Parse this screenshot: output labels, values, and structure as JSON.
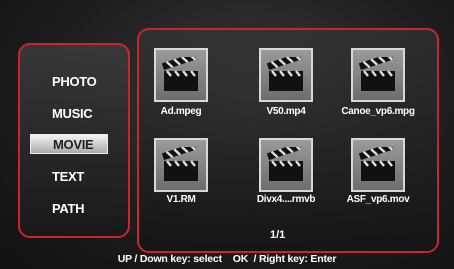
{
  "sidebar": {
    "items": [
      {
        "label": "PHOTO",
        "selected": false
      },
      {
        "label": "MUSIC",
        "selected": false
      },
      {
        "label": "MOVIE",
        "selected": true
      },
      {
        "label": "TEXT",
        "selected": false
      },
      {
        "label": "PATH",
        "selected": false
      }
    ]
  },
  "files": [
    {
      "name": "Ad.mpeg",
      "icon": "clapperboard-icon"
    },
    {
      "name": "V50.mp4",
      "icon": "clapperboard-icon"
    },
    {
      "name": "Canoe_vp6.mpg",
      "icon": "clapperboard-icon"
    },
    {
      "name": "V1.RM",
      "icon": "clapperboard-icon"
    },
    {
      "name": "Divx4....rmvb",
      "icon": "clapperboard-icon"
    },
    {
      "name": "ASF_vp6.mov",
      "icon": "clapperboard-icon"
    }
  ],
  "pager": "1/1",
  "hint": "UP / Down key: select    OK  / Right key: Enter",
  "colors": {
    "accent": "#c8262c",
    "background": "#2a2a2a"
  }
}
